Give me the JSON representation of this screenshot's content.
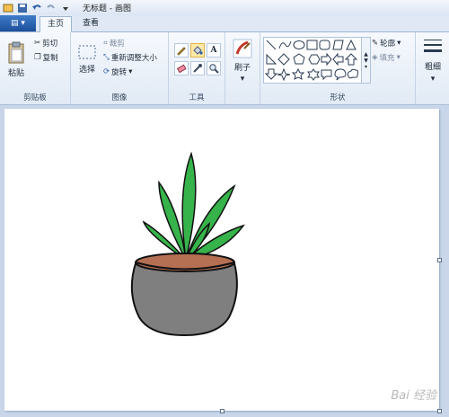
{
  "window": {
    "title": "无标题 - 画图"
  },
  "tabs": {
    "file_label": "▤ ▾",
    "home": "主页",
    "view": "查看"
  },
  "clipboard": {
    "paste": "粘贴",
    "cut": "剪切",
    "copy": "复制",
    "group": "剪贴板"
  },
  "image": {
    "select": "选择",
    "crop": "裁剪",
    "resize": "重新调整大小",
    "rotate": "旋转",
    "group": "图像"
  },
  "tools": {
    "group": "工具"
  },
  "brush": {
    "label": "刷子"
  },
  "shapes": {
    "group": "形状",
    "outline": "轮廓",
    "fill": "填充"
  },
  "size": {
    "label": "粗细"
  },
  "watermark": {
    "text": "Bai 经验"
  },
  "colors": {
    "accent": "#1c4f9a",
    "plant_leaf": "#36b34a",
    "pot": "#7f7f7f",
    "soil": "#b56f52"
  }
}
